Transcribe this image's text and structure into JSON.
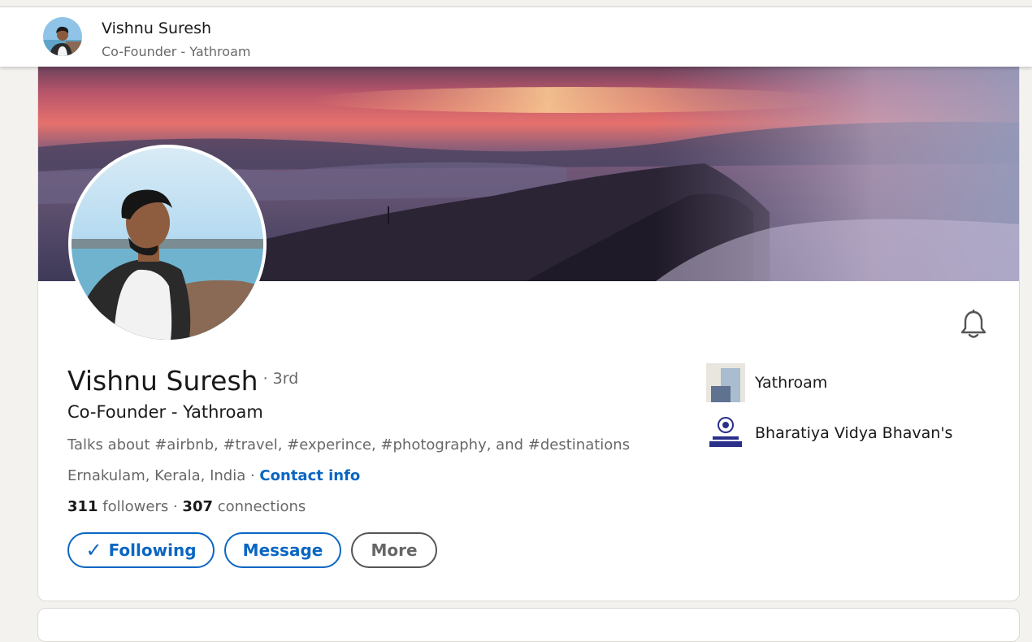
{
  "sticky_header": {
    "name": "Vishnu Suresh",
    "title": "Co-Founder - Yathroam"
  },
  "profile": {
    "name": "Vishnu Suresh",
    "degree": "· 3rd",
    "headline": "Co-Founder - Yathroam",
    "talks_about": "Talks about #airbnb, #travel, #experince, #photography, and #destinations",
    "location": "Ernakulam, Kerala, India",
    "separator": " · ",
    "contact_info": "Contact info",
    "followers_count": "311",
    "followers_label": " followers ",
    "stats_sep": " · ",
    "connections_count": "307",
    "connections_label": " connections"
  },
  "actions": {
    "following": "Following",
    "message": "Message",
    "more": "More"
  },
  "organizations": [
    {
      "name": "Yathroam",
      "icon": "company-logo"
    },
    {
      "name": "Bharatiya Vidya Bhavan's",
      "icon": "school-logo"
    }
  ],
  "colors": {
    "accent": "#0a66c2",
    "background": "#f3f2ef"
  }
}
